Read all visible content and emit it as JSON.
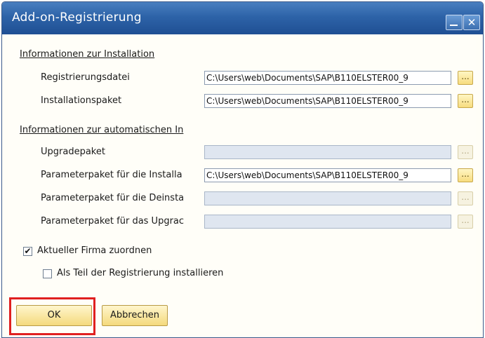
{
  "window": {
    "title": "Add-on-Registrierung"
  },
  "titlebar_icons": {
    "minimize": "minimize-icon",
    "close": "close-icon",
    "close_glyph": "✕"
  },
  "installation": {
    "heading": "Informationen zur Installation",
    "rows": [
      {
        "label": "Registrierungsdatei",
        "value": "C:\\Users\\web\\Documents\\SAP\\B110ELSTER00_9"
      },
      {
        "label": "Installationspaket",
        "value": "C:\\Users\\web\\Documents\\SAP\\B110ELSTER00_9"
      }
    ]
  },
  "automatic": {
    "heading": "Informationen zur automatischen In",
    "rows": [
      {
        "label": "Upgradepaket",
        "value": ""
      },
      {
        "label": "Parameterpaket für die Installa",
        "value": "C:\\Users\\web\\Documents\\SAP\\B110ELSTER00_9"
      },
      {
        "label": "Parameterpaket für die Deinsta",
        "value": ""
      },
      {
        "label": "Parameterpaket für das Upgrac",
        "value": ""
      }
    ]
  },
  "browse_label": "...",
  "options": {
    "assign_company": {
      "label": "Aktueller Firma zuordnen",
      "checked": true,
      "check_glyph": "✔"
    },
    "install_as_part": {
      "label": "Als Teil der Registrierung installieren",
      "checked": false
    }
  },
  "buttons": {
    "ok": "OK",
    "cancel": "Abbrechen"
  },
  "colors": {
    "titlebar": "#2d63a8",
    "button_gold": "#f4d97c",
    "highlight_red": "#e02020"
  }
}
